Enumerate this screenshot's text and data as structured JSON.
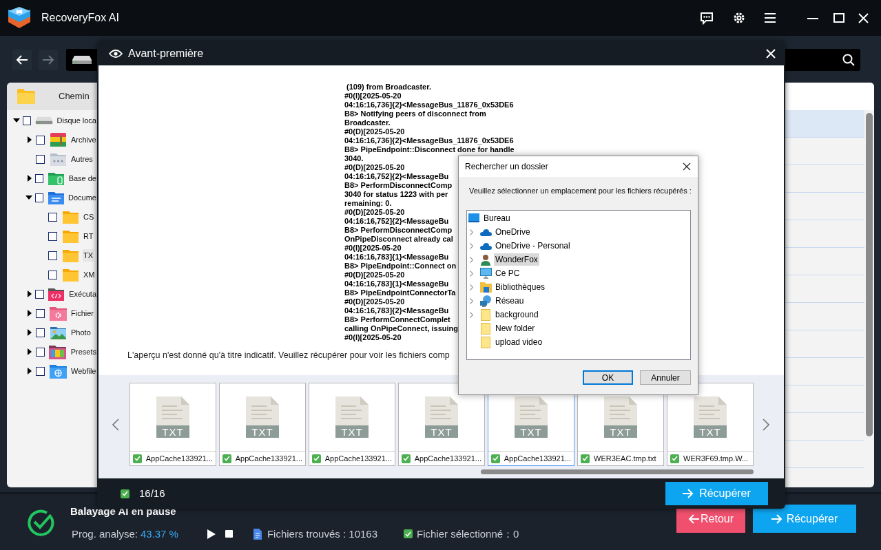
{
  "window": {
    "title": "RecoveryFox AI"
  },
  "tree": [
    {
      "label": "Disque loca",
      "kind": "drive",
      "checked": false,
      "selected": false,
      "expanded": true,
      "children": [
        {
          "label": "Archive",
          "kind": "archive",
          "checked": false,
          "selected": false,
          "expanded": false
        },
        {
          "label": "Autres",
          "kind": "other",
          "checked": false,
          "selected": false
        },
        {
          "label": "Base de",
          "kind": "database",
          "checked": false,
          "selected": false,
          "expanded": false
        },
        {
          "label": "Docume",
          "kind": "document",
          "checked": false,
          "selected": false,
          "expanded": true,
          "children": [
            {
              "label": "CS",
              "kind": "folder",
              "checked": false,
              "selected": false
            },
            {
              "label": "RT",
              "kind": "folder",
              "checked": false,
              "selected": false
            },
            {
              "label": "TX",
              "kind": "folder",
              "checked": false,
              "selected": true
            },
            {
              "label": "XM",
              "kind": "folder",
              "checked": false,
              "selected": false
            }
          ]
        },
        {
          "label": "Exécuta",
          "kind": "executable",
          "checked": false,
          "selected": false,
          "expanded": false
        },
        {
          "label": "Fichier",
          "kind": "settings",
          "checked": false,
          "selected": false,
          "expanded": false
        },
        {
          "label": "Photo",
          "kind": "photo",
          "checked": false,
          "selected": false,
          "expanded": false
        },
        {
          "label": "Presets",
          "kind": "presets",
          "checked": false,
          "selected": false,
          "expanded": false
        },
        {
          "label": "Webfile",
          "kind": "web",
          "checked": false,
          "selected": false,
          "expanded": false
        }
      ]
    }
  ],
  "tree_header": "Chemin",
  "file_list": {
    "rows": [
      {
        "selected": true
      },
      {
        "selected": false
      },
      {
        "selected": false
      },
      {
        "selected": false
      },
      {
        "selected": false
      },
      {
        "selected": false
      },
      {
        "selected": false
      },
      {
        "selected": false
      },
      {
        "selected": false
      },
      {
        "selected": false
      },
      {
        "selected": false
      },
      {
        "selected": false
      },
      {
        "selected": false
      }
    ]
  },
  "preview": {
    "title": "Avant-première",
    "log_lines": [
      " (109) from Broadcaster.",
      "#0(I)[2025-05-20",
      "04:16:16,736]{2}<MessageBus_11876_0x53DE6",
      "B8> Notifying peers of disconnect from",
      "Broadcaster.",
      "#0(D)[2025-05-20",
      "04:16:16,736]{2}<MessageBus_11876_0x53DE6",
      "B8> PipeEndpoint::Disconnect done for handle",
      "3040.",
      "#0(D)[2025-05-20",
      "04:16:16,752]{2}<MessageBu",
      "B8> PerformDisconnectComp",
      "3040 for status 1223 with per",
      "remaining: 0.",
      "#0(D)[2025-05-20",
      "04:16:16,752]{2}<MessageBu",
      "B8> PerformDisconnectComp",
      "OnPipeDisconnect already cal",
      "#0(I)[2025-05-20",
      "04:16:16,783]{1}<MessageBu",
      "B8> PipeEndpoint::Connect on",
      "#0(D)[2025-05-20",
      "04:16:16,783]{1}<MessageBu",
      "B8> PipeEndpointConnectorTa",
      "#0(D)[2025-05-20",
      "04:16:16,783]{2}<MessageBu",
      "B8> PerformConnectComplet",
      "calling OnPipeConnect, issuing",
      "#0(I)[2025-05-20"
    ],
    "notice": "L'aperçu n'est donné qu'à titre indicatif. Veuillez récupérer pour voir les fichiers comp",
    "thumbnails": [
      {
        "badge": "TXT",
        "name": "AppCache133921...",
        "checked": true,
        "selected": false
      },
      {
        "badge": "TXT",
        "name": "AppCache133921...",
        "checked": true,
        "selected": false
      },
      {
        "badge": "TXT",
        "name": "AppCache133921...",
        "checked": true,
        "selected": false
      },
      {
        "badge": "TXT",
        "name": "AppCache133921...",
        "checked": true,
        "selected": false
      },
      {
        "badge": "TXT",
        "name": "AppCache133921...",
        "checked": true,
        "selected": true
      },
      {
        "badge": "TXT",
        "name": "WER3EAC.tmp.txt",
        "checked": true,
        "selected": false
      },
      {
        "badge": "TXT",
        "name": "WER3F69.tmp.W...",
        "checked": true,
        "selected": false
      }
    ],
    "count": {
      "checked": true,
      "text": "16/16"
    },
    "recover_button": "Récupérer"
  },
  "folder_dialog": {
    "title": "Rechercher un dossier",
    "prompt": "Veuillez sélectionner un emplacement pour les fichiers récupérés :",
    "items": [
      {
        "label": "Bureau",
        "kind": "desktop",
        "expandable": false,
        "selected": false
      },
      {
        "label": "OneDrive",
        "kind": "cloud",
        "expandable": true,
        "selected": false
      },
      {
        "label": "OneDrive - Personal",
        "kind": "cloud",
        "expandable": true,
        "selected": false
      },
      {
        "label": "WonderFox",
        "kind": "user",
        "expandable": true,
        "selected": true
      },
      {
        "label": "Ce PC",
        "kind": "pc",
        "expandable": true,
        "selected": false
      },
      {
        "label": "Bibliothèques",
        "kind": "library",
        "expandable": true,
        "selected": false
      },
      {
        "label": "Réseau",
        "kind": "network",
        "expandable": true,
        "selected": false
      },
      {
        "label": "background",
        "kind": "folder",
        "expandable": true,
        "selected": false
      },
      {
        "label": "New folder",
        "kind": "folder",
        "expandable": false,
        "selected": false
      },
      {
        "label": "upload video",
        "kind": "folder",
        "expandable": false,
        "selected": false
      }
    ],
    "buttons": [
      "OK",
      "Annuler"
    ]
  },
  "status": {
    "title": "Balayage AI en pause",
    "progress_label": "Prog. analyse:",
    "progress_value": "43.37 %",
    "found": "Fichiers trouvés : 10163",
    "selected_text": "Fichier sélectionné：0",
    "selected_checked": true
  },
  "buttons": {
    "back": "Retour",
    "recover": "Récupérer"
  }
}
